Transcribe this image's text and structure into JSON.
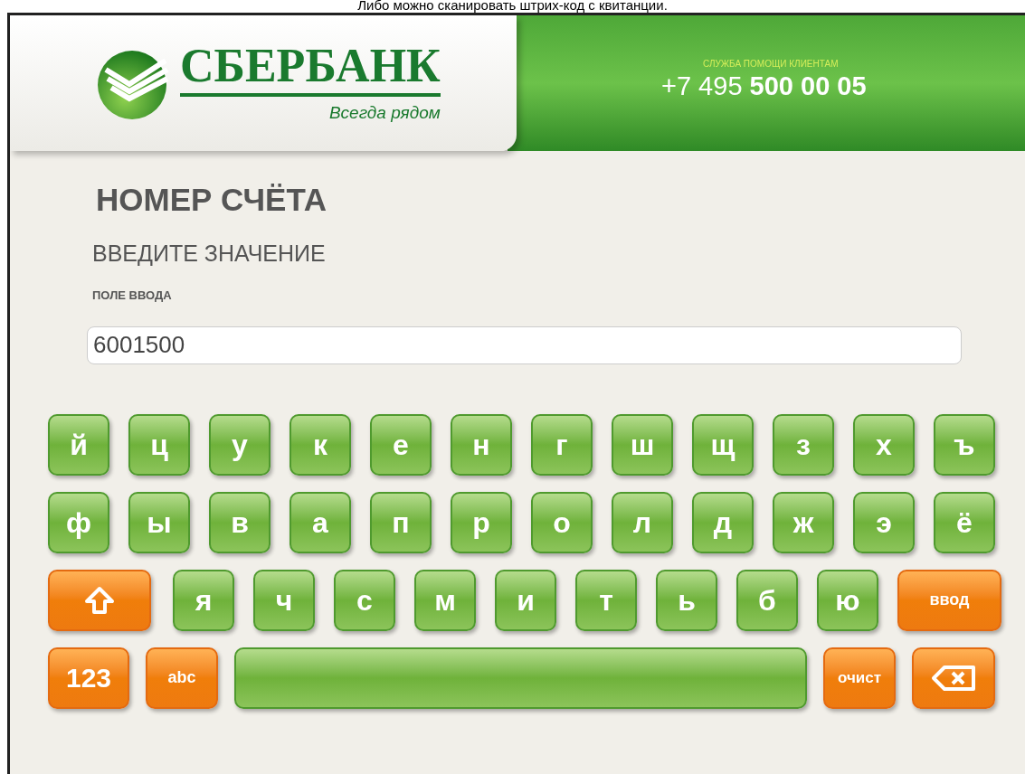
{
  "top_caption": "Либо можно сканировать штрих-код с квитанции.",
  "header": {
    "brand": "СБЕРБАНК",
    "slogan": "Всегда рядом",
    "help_label": "СЛУЖБА ПОМОЩИ КЛИЕНТАМ",
    "phone_prefix": "+7 495",
    "phone_number": "500 00 05"
  },
  "title": "НОМЕР СЧЁТА",
  "subtitle": "ВВЕДИТЕ ЗНАЧЕНИЕ",
  "field": {
    "label": "ПОЛЕ ВВОДА",
    "value": "6001500"
  },
  "keyboard": {
    "rows": [
      {
        "keys": [
          {
            "kind": "letter",
            "label": "й"
          },
          {
            "kind": "letter",
            "label": "ц"
          },
          {
            "kind": "letter",
            "label": "у"
          },
          {
            "kind": "letter",
            "label": "к"
          },
          {
            "kind": "letter",
            "label": "е"
          },
          {
            "kind": "letter",
            "label": "н"
          },
          {
            "kind": "letter",
            "label": "г"
          },
          {
            "kind": "letter",
            "label": "ш"
          },
          {
            "kind": "letter",
            "label": "щ"
          },
          {
            "kind": "letter",
            "label": "з"
          },
          {
            "kind": "letter",
            "label": "х"
          },
          {
            "kind": "letter",
            "label": "ъ"
          }
        ]
      },
      {
        "keys": [
          {
            "kind": "letter",
            "label": "ф"
          },
          {
            "kind": "letter",
            "label": "ы"
          },
          {
            "kind": "letter",
            "label": "в"
          },
          {
            "kind": "letter",
            "label": "а"
          },
          {
            "kind": "letter",
            "label": "п"
          },
          {
            "kind": "letter",
            "label": "р"
          },
          {
            "kind": "letter",
            "label": "о"
          },
          {
            "kind": "letter",
            "label": "л"
          },
          {
            "kind": "letter",
            "label": "д"
          },
          {
            "kind": "letter",
            "label": "ж"
          },
          {
            "kind": "letter",
            "label": "э"
          },
          {
            "kind": "letter",
            "label": "ё"
          }
        ]
      },
      {
        "keys": [
          {
            "kind": "shift"
          },
          {
            "kind": "letter",
            "label": "я"
          },
          {
            "kind": "letter",
            "label": "ч"
          },
          {
            "kind": "letter",
            "label": "с"
          },
          {
            "kind": "letter",
            "label": "м"
          },
          {
            "kind": "letter",
            "label": "и"
          },
          {
            "kind": "letter",
            "label": "т"
          },
          {
            "kind": "letter",
            "label": "ь"
          },
          {
            "kind": "letter",
            "label": "б"
          },
          {
            "kind": "letter",
            "label": "ю"
          },
          {
            "kind": "enter",
            "label": "ввод"
          }
        ]
      },
      {
        "keys": [
          {
            "kind": "numbers",
            "label": "123"
          },
          {
            "kind": "abc",
            "label": "abc"
          },
          {
            "kind": "space"
          },
          {
            "kind": "clear",
            "label": "очист"
          },
          {
            "kind": "backspace"
          }
        ]
      }
    ]
  }
}
